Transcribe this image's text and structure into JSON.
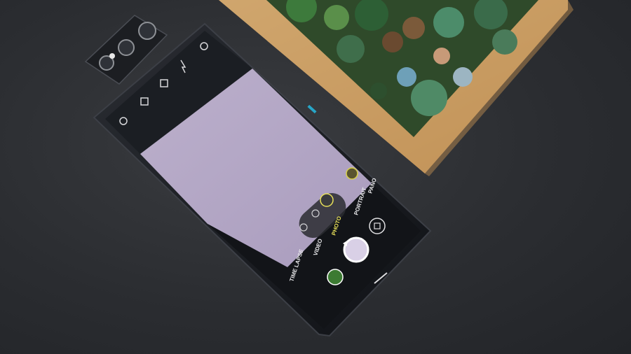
{
  "camera_app": {
    "modes": [
      {
        "label": "TIME LAPSE",
        "selected": false
      },
      {
        "label": "VIDEO",
        "selected": false
      },
      {
        "label": "PHOTO",
        "selected": true
      },
      {
        "label": "PORTRAIT",
        "selected": false
      },
      {
        "label": "PANO",
        "selected": false
      }
    ]
  },
  "colors": {
    "background": "#2b2d31",
    "phone_body": "#15171b",
    "viewfinder": "#b2a6c4",
    "selected_mode": "#e8e05a",
    "frame_wood": "#d9b27a",
    "moss_green": "#3d7a3c"
  },
  "icons": [
    "settings-icon",
    "flash-icon",
    "hdr-icon",
    "timer-icon",
    "ratio-icon",
    "filter-icon",
    "beauty-icon",
    "wide-lens-icon",
    "ai-scene-icon",
    "switch-camera-icon",
    "gallery-thumbnail",
    "shutter-button",
    "flip-camera-module"
  ]
}
